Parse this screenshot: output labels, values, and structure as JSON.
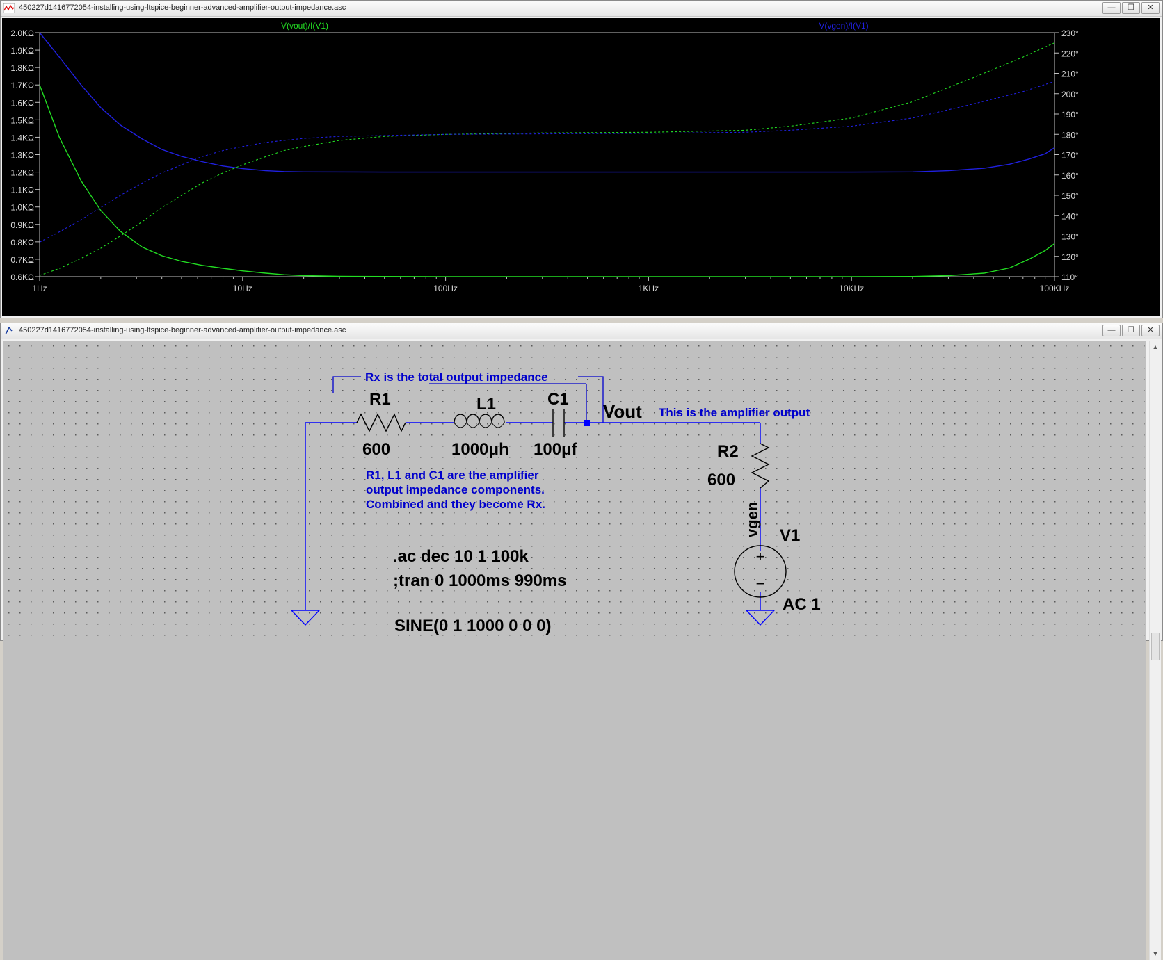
{
  "plot_window": {
    "title": "450227d1416772054-installing-using-ltspice-beginner-advanced-amplifier-output-impedance.asc",
    "buttons": {
      "minimize": "—",
      "restore": "❐",
      "close": "✕"
    }
  },
  "schematic_window": {
    "title": "450227d1416772054-installing-using-ltspice-beginner-advanced-amplifier-output-impedance.asc",
    "buttons": {
      "minimize": "—",
      "restore": "❐",
      "close": "✕"
    }
  },
  "chart_data": {
    "type": "line",
    "x_scale": "log",
    "x_range": [
      1,
      100000
    ],
    "x_ticks": [
      {
        "v": 1,
        "label": "1Hz"
      },
      {
        "v": 10,
        "label": "10Hz"
      },
      {
        "v": 100,
        "label": "100Hz"
      },
      {
        "v": 1000,
        "label": "1KHz"
      },
      {
        "v": 10000,
        "label": "10KHz"
      },
      {
        "v": 100000,
        "label": "100KHz"
      }
    ],
    "left_axis": {
      "range": [
        600,
        2000
      ],
      "ticks": [
        {
          "v": 2000,
          "label": "2.0KΩ"
        },
        {
          "v": 1900,
          "label": "1.9KΩ"
        },
        {
          "v": 1800,
          "label": "1.8KΩ"
        },
        {
          "v": 1700,
          "label": "1.7KΩ"
        },
        {
          "v": 1600,
          "label": "1.6KΩ"
        },
        {
          "v": 1500,
          "label": "1.5KΩ"
        },
        {
          "v": 1400,
          "label": "1.4KΩ"
        },
        {
          "v": 1300,
          "label": "1.3KΩ"
        },
        {
          "v": 1200,
          "label": "1.2KΩ"
        },
        {
          "v": 1100,
          "label": "1.1KΩ"
        },
        {
          "v": 1000,
          "label": "1.0KΩ"
        },
        {
          "v": 900,
          "label": "0.9KΩ"
        },
        {
          "v": 800,
          "label": "0.8KΩ"
        },
        {
          "v": 700,
          "label": "0.7KΩ"
        },
        {
          "v": 600,
          "label": "0.6KΩ"
        }
      ]
    },
    "right_axis": {
      "range": [
        110,
        230
      ],
      "ticks": [
        {
          "v": 230,
          "label": "230°"
        },
        {
          "v": 220,
          "label": "220°"
        },
        {
          "v": 210,
          "label": "210°"
        },
        {
          "v": 200,
          "label": "200°"
        },
        {
          "v": 190,
          "label": "190°"
        },
        {
          "v": 180,
          "label": "180°"
        },
        {
          "v": 170,
          "label": "170°"
        },
        {
          "v": 160,
          "label": "160°"
        },
        {
          "v": 150,
          "label": "150°"
        },
        {
          "v": 140,
          "label": "140°"
        },
        {
          "v": 130,
          "label": "130°"
        },
        {
          "v": 120,
          "label": "120°"
        },
        {
          "v": 110,
          "label": "110°"
        }
      ]
    },
    "series": [
      {
        "name": "V(vout)/I(V1)",
        "color": "#22dd22",
        "kind": "magnitude",
        "points": [
          [
            1,
            1700
          ],
          [
            1.25,
            1400
          ],
          [
            1.6,
            1150
          ],
          [
            2,
            980
          ],
          [
            2.5,
            860
          ],
          [
            3.2,
            770
          ],
          [
            4,
            720
          ],
          [
            5,
            688
          ],
          [
            6.3,
            665
          ],
          [
            8,
            648
          ],
          [
            10,
            633
          ],
          [
            13,
            620
          ],
          [
            16,
            611
          ],
          [
            20,
            606
          ],
          [
            30,
            602
          ],
          [
            50,
            601
          ],
          [
            100,
            600
          ],
          [
            1000,
            600
          ],
          [
            10000,
            600
          ],
          [
            20000,
            601
          ],
          [
            30000,
            606
          ],
          [
            45000,
            620
          ],
          [
            60000,
            650
          ],
          [
            75000,
            700
          ],
          [
            90000,
            750
          ],
          [
            100000,
            790
          ]
        ]
      },
      {
        "name": "V(vout)/I(V1)",
        "color": "#22dd22",
        "kind": "phase",
        "points": [
          [
            1,
            110.6
          ],
          [
            1.25,
            114
          ],
          [
            1.6,
            119
          ],
          [
            2,
            124
          ],
          [
            2.5,
            130
          ],
          [
            3.2,
            137
          ],
          [
            4,
            144
          ],
          [
            5,
            150
          ],
          [
            6.3,
            156
          ],
          [
            8,
            161
          ],
          [
            10,
            165
          ],
          [
            13,
            169
          ],
          [
            16,
            172
          ],
          [
            20,
            174
          ],
          [
            30,
            177
          ],
          [
            50,
            179
          ],
          [
            100,
            180
          ],
          [
            300,
            180.7
          ],
          [
            1000,
            181
          ],
          [
            3000,
            182
          ],
          [
            5000,
            184
          ],
          [
            10000,
            188
          ],
          [
            20000,
            196
          ],
          [
            40000,
            208
          ],
          [
            70000,
            218
          ],
          [
            100000,
            225
          ]
        ]
      },
      {
        "name": "V(vgen)/I(V1)",
        "color": "#2020e0",
        "kind": "magnitude",
        "points": [
          [
            1,
            2000
          ],
          [
            1.25,
            1860
          ],
          [
            1.6,
            1700
          ],
          [
            2,
            1570
          ],
          [
            2.5,
            1470
          ],
          [
            3.2,
            1390
          ],
          [
            4,
            1330
          ],
          [
            5,
            1290
          ],
          [
            6.3,
            1260
          ],
          [
            8,
            1235
          ],
          [
            10,
            1220
          ],
          [
            13,
            1208
          ],
          [
            16,
            1203
          ],
          [
            20,
            1201
          ],
          [
            50,
            1200
          ],
          [
            100,
            1200
          ],
          [
            1000,
            1200
          ],
          [
            10000,
            1200
          ],
          [
            20000,
            1201
          ],
          [
            30000,
            1208
          ],
          [
            45000,
            1222
          ],
          [
            60000,
            1245
          ],
          [
            75000,
            1275
          ],
          [
            90000,
            1305
          ],
          [
            100000,
            1340
          ]
        ]
      },
      {
        "name": "V(vgen)/I(V1)",
        "color": "#2020e0",
        "kind": "phase",
        "points": [
          [
            1,
            127
          ],
          [
            1.25,
            132
          ],
          [
            1.6,
            138
          ],
          [
            2,
            144
          ],
          [
            2.5,
            150
          ],
          [
            3.2,
            156
          ],
          [
            4,
            161
          ],
          [
            5,
            165
          ],
          [
            6.3,
            169
          ],
          [
            8,
            172
          ],
          [
            10,
            174
          ],
          [
            13,
            176
          ],
          [
            16,
            177
          ],
          [
            20,
            178
          ],
          [
            30,
            179
          ],
          [
            100,
            180
          ],
          [
            1000,
            180.5
          ],
          [
            3000,
            181
          ],
          [
            5000,
            182
          ],
          [
            10000,
            184
          ],
          [
            20000,
            188
          ],
          [
            40000,
            195
          ],
          [
            70000,
            201
          ],
          [
            100000,
            206
          ]
        ]
      }
    ],
    "legend": [
      {
        "label": "V(vout)/I(V1)",
        "color": "#22dd22"
      },
      {
        "label": "V(vgen)/I(V1)",
        "color": "#2020e0"
      }
    ]
  },
  "schematic": {
    "labels": {
      "r1_name": "R1",
      "r1_value": "600",
      "l1_name": "L1",
      "l1_value": "1000μh",
      "c1_name": "C1",
      "c1_value": "100μf",
      "vout": "Vout",
      "r2_name": "R2",
      "r2_value": "600",
      "vgen": "vgen",
      "v1_name": "V1",
      "v1_value": "AC 1",
      "v1_plus": "+",
      "v1_minus": "−"
    },
    "comments": {
      "rx_total": "Rx is the total output impedance",
      "amp_output": "This is the amplifier output",
      "components_line1": "R1, L1 and C1 are the amplifier",
      "components_line2": "output impedance components.",
      "components_line3": "Combined and they become Rx."
    },
    "directives": {
      "ac": ".ac dec 10 1 100k",
      "tran": ";tran 0 1000ms 990ms",
      "sine": "SINE(0 1 1000 0 0 0)"
    },
    "colors": {
      "wire": "#0000ff",
      "comment": "#0000cc",
      "label": "#000000",
      "background": "#c0c0c0"
    }
  }
}
